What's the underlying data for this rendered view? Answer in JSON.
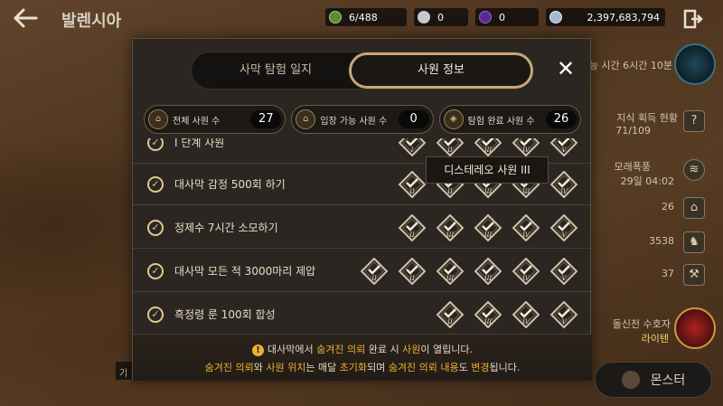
{
  "header": {
    "back_icon": "arrow-left-icon",
    "title": "발렌시아",
    "resources": [
      {
        "icon": "energy-icon",
        "value": "6/488"
      },
      {
        "icon": "pearl-icon",
        "value": "0"
      },
      {
        "icon": "crystal-icon",
        "value": "0"
      },
      {
        "icon": "silver-icon",
        "value": "2,397,683,794"
      }
    ],
    "exit_icon": "exit-icon"
  },
  "side": {
    "time_text": "능 시간 6시간 10분",
    "knowledge_title": "지식 획득 현황",
    "knowledge_value": "71/109",
    "sandstorm_title": "모래폭풍",
    "sandstorm_time": "29일 04:02",
    "count_temples": "26",
    "count_camels": "3538",
    "count_pick": "37",
    "guardian_text": "돌신전 수호자",
    "guardian_sub": "라이텐",
    "monster_button": "몬스터",
    "left_chip": "기"
  },
  "modal": {
    "tabs": [
      {
        "label": "사막 탐험 일지",
        "active": false
      },
      {
        "label": "사원 정보",
        "active": true
      }
    ],
    "close_icon": "close-icon",
    "stats": [
      {
        "label": "전체 사원 수",
        "value": "27"
      },
      {
        "label": "입장 가능 사원 수",
        "value": "0"
      },
      {
        "label": "탐험 완료 사원 수",
        "value": "26"
      }
    ],
    "rows": [
      {
        "label": "Ⅰ 단계 사원",
        "badges": [
          "I",
          "II",
          "III",
          "IV",
          "V"
        ]
      },
      {
        "label": "대사막 감정 500회 하기",
        "badges": [
          "II",
          "II",
          "III",
          "III",
          "IV"
        ]
      },
      {
        "label": "정제수 7시간 소모하기",
        "badges": [
          "II",
          "III",
          "III",
          "IV",
          "V"
        ]
      },
      {
        "label": "대사막 모든 적 3000마리 제압",
        "badges": [
          "II",
          "II",
          "III",
          "III",
          "IV",
          "V"
        ]
      },
      {
        "label": "흑정령 룬 100회 합성",
        "badges": [
          "II",
          "III",
          "IV",
          "V"
        ]
      }
    ],
    "tooltip": "디스테레오 사원 III",
    "footer": {
      "line1_a": "대사막에서 ",
      "line1_b": "숨겨진 의뢰",
      "line1_c": " 완료 시 ",
      "line1_d": "사원",
      "line1_e": "이 열립니다.",
      "line2_a": "숨겨진 의뢰",
      "line2_b": "와 ",
      "line2_c": "사원 위치",
      "line2_d": "는 매달 ",
      "line2_e": "초기화",
      "line2_f": "되며 ",
      "line2_g": "숨겨진 의뢰 내용",
      "line2_h": "도 ",
      "line2_i": "변경",
      "line2_j": "됩니다."
    }
  },
  "colors": {
    "accent_gold": "#c8a678",
    "highlight": "#f0b030",
    "panel": "#2b2622"
  }
}
